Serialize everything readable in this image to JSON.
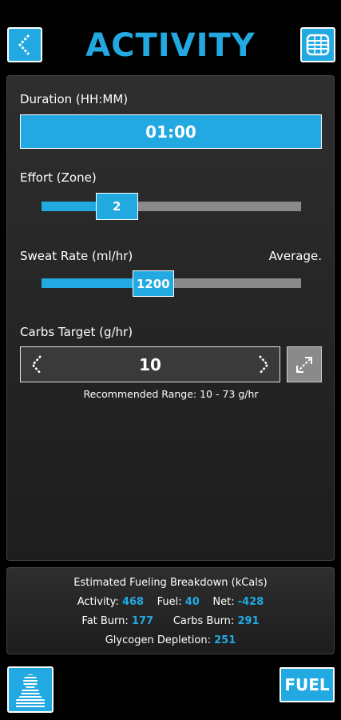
{
  "header": {
    "title": "ACTIVITY"
  },
  "duration": {
    "label": "Duration (HH:MM)",
    "value": "01:00"
  },
  "effort": {
    "label": "Effort (Zone)",
    "value": "2",
    "level": 0.29
  },
  "sweat": {
    "label": "Sweat Rate (ml/hr)",
    "descriptor": "Average.",
    "value": "1200",
    "level": 0.43
  },
  "carbs": {
    "label": "Carbs Target (g/hr)",
    "value": "10",
    "hint": "Recommended Range: 10 - 73 g/hr"
  },
  "breakdown": {
    "title": "Estimated Fueling Breakdown (kCals)",
    "activity_label": "Activity:",
    "activity_value": "468",
    "fuel_label": "Fuel:",
    "fuel_value": "40",
    "net_label": "Net:",
    "net_value": "-428",
    "fat_label": "Fat Burn:",
    "fat_value": "177",
    "carbs_label": "Carbs Burn:",
    "carbs_value": "291",
    "glycogen_label": "Glycogen Depletion:",
    "glycogen_value": "251"
  },
  "footer": {
    "fuel_button": "FUEL"
  },
  "colors": {
    "accent": "#22a9e1",
    "track": "#8a8a8a",
    "background": "#000000"
  },
  "icons": [
    "chevron-left-icon",
    "menu-grid-icon",
    "chevron-right-icon",
    "expand-icon",
    "profile-icon"
  ]
}
